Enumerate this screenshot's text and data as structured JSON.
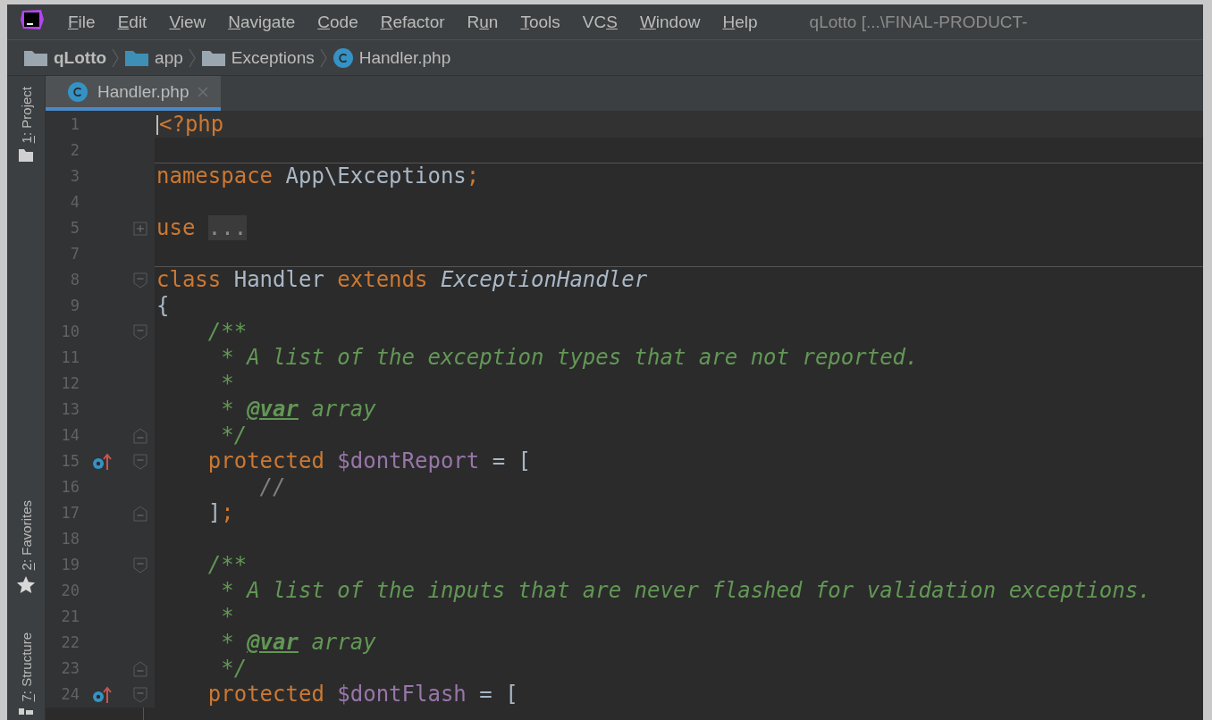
{
  "menu": [
    {
      "key": "F",
      "after": "ile"
    },
    {
      "key": "E",
      "after": "dit"
    },
    {
      "key": "V",
      "after": "iew"
    },
    {
      "key": "N",
      "after": "avigate"
    },
    {
      "key": "C",
      "after": "ode"
    },
    {
      "key": "R",
      "after": "efactor"
    },
    {
      "before": "R",
      "key": "u",
      "after": "n"
    },
    {
      "key": "T",
      "after": "ools"
    },
    {
      "before": "VC",
      "key": "S"
    },
    {
      "key": "W",
      "after": "indow"
    },
    {
      "key": "H",
      "after": "elp"
    }
  ],
  "window": {
    "title": "qLotto [...\\FINAL-PRODUCT-"
  },
  "breadcrumbs": [
    {
      "label": "qLotto",
      "kind": "project"
    },
    {
      "label": "app",
      "kind": "source"
    },
    {
      "label": "Exceptions",
      "kind": "folder"
    },
    {
      "label": "Handler.php",
      "kind": "class"
    }
  ],
  "tabs": [
    {
      "label": "Handler.php",
      "selected": true
    }
  ],
  "tool_windows_top": [
    {
      "key": "1",
      "after": ": Project",
      "kind": "folder"
    }
  ],
  "tool_windows_bottom": [
    {
      "key": "2",
      "after": ": Favorites",
      "kind": "star"
    },
    {
      "key": "7",
      "after": ": Structure",
      "kind": "structure"
    }
  ],
  "lines": [
    {
      "number": "1",
      "current": true,
      "separator": false,
      "tokens": [
        {
          "text": "<?php",
          "kind": "keyword"
        }
      ]
    },
    {
      "number": "2",
      "current": false,
      "separator": true
    },
    {
      "number": "3",
      "current": false,
      "separator": false,
      "tokens": [
        {
          "text": "namespace",
          "kind": "keyword"
        },
        {
          "text": " App\\Exceptions",
          "kind": "plain"
        },
        {
          "text": ";",
          "kind": "keyword"
        }
      ]
    },
    {
      "number": "4",
      "current": false,
      "separator": false
    },
    {
      "number": "5",
      "current": false,
      "separator": false,
      "marks": [
        {
          "kind": "folded"
        }
      ],
      "tokens": [
        {
          "text": "use ",
          "kind": "keyword"
        },
        {
          "text": "...",
          "kind": "folded"
        }
      ]
    },
    {
      "number": "7",
      "current": false,
      "separator": true
    },
    {
      "number": "8",
      "current": false,
      "separator": false,
      "marks": [
        {
          "kind": "fold-start"
        }
      ],
      "tokens": [
        {
          "text": "class",
          "kind": "keyword"
        },
        {
          "text": " Handler ",
          "kind": "plain"
        },
        {
          "text": "extends ",
          "kind": "keyword"
        },
        {
          "text": "ExceptionHandler",
          "kind": "italic"
        }
      ]
    },
    {
      "number": "9",
      "current": false,
      "separator": false,
      "tokens": [
        {
          "text": "{",
          "kind": "plain"
        }
      ]
    },
    {
      "number": "10",
      "current": false,
      "separator": false,
      "marks": [
        {
          "kind": "fold-start"
        }
      ],
      "tokens": [
        {
          "text": "    /**",
          "kind": "comment"
        }
      ]
    },
    {
      "number": "11",
      "current": false,
      "separator": false,
      "tokens": [
        {
          "text": "     * A list of the exception types that are not reported.",
          "kind": "comment"
        }
      ]
    },
    {
      "number": "12",
      "current": false,
      "separator": false,
      "tokens": [
        {
          "text": "     *",
          "kind": "comment"
        }
      ]
    },
    {
      "number": "13",
      "current": false,
      "separator": false,
      "tokens": [
        {
          "text": "     * ",
          "kind": "comment"
        },
        {
          "text": "@var",
          "kind": "doctag"
        },
        {
          "text": " array",
          "kind": "comment"
        }
      ]
    },
    {
      "number": "14",
      "current": false,
      "separator": false,
      "marks": [
        {
          "kind": "fold-end"
        }
      ],
      "tokens": [
        {
          "text": "     */",
          "kind": "comment"
        }
      ]
    },
    {
      "number": "15",
      "current": false,
      "separator": false,
      "marks": [
        {
          "kind": "override"
        },
        {
          "kind": "fold-start"
        }
      ],
      "tokens": [
        {
          "text": "    protected ",
          "kind": "keyword"
        },
        {
          "text": "$dontReport",
          "kind": "variable"
        },
        {
          "text": " = [",
          "kind": "plain"
        }
      ]
    },
    {
      "number": "16",
      "current": false,
      "separator": false,
      "tokens": [
        {
          "text": "        //",
          "kind": "line-comment"
        }
      ]
    },
    {
      "number": "17",
      "current": false,
      "separator": false,
      "marks": [
        {
          "kind": "fold-end"
        }
      ],
      "tokens": [
        {
          "text": "    ]",
          "kind": "plain"
        },
        {
          "text": ";",
          "kind": "keyword"
        }
      ]
    },
    {
      "number": "18",
      "current": false,
      "separator": false
    },
    {
      "number": "19",
      "current": false,
      "separator": false,
      "marks": [
        {
          "kind": "fold-start"
        }
      ],
      "tokens": [
        {
          "text": "    /**",
          "kind": "comment"
        }
      ]
    },
    {
      "number": "20",
      "current": false,
      "separator": false,
      "tokens": [
        {
          "text": "     * A list of the inputs that are never flashed for validation exceptions.",
          "kind": "comment"
        }
      ]
    },
    {
      "number": "21",
      "current": false,
      "separator": false,
      "tokens": [
        {
          "text": "     *",
          "kind": "comment"
        }
      ]
    },
    {
      "number": "22",
      "current": false,
      "separator": false,
      "tokens": [
        {
          "text": "     * ",
          "kind": "comment"
        },
        {
          "text": "@var",
          "kind": "doctag"
        },
        {
          "text": " array",
          "kind": "comment"
        }
      ]
    },
    {
      "number": "23",
      "current": false,
      "separator": false,
      "marks": [
        {
          "kind": "fold-end"
        }
      ],
      "tokens": [
        {
          "text": "     */",
          "kind": "comment"
        }
      ]
    },
    {
      "number": "24",
      "current": false,
      "separator": false,
      "marks": [
        {
          "kind": "override"
        },
        {
          "kind": "fold-start"
        }
      ],
      "tokens": [
        {
          "text": "    protected ",
          "kind": "keyword"
        },
        {
          "text": "$dontFlash",
          "kind": "variable"
        },
        {
          "text": " = [",
          "kind": "plain"
        }
      ]
    }
  ]
}
